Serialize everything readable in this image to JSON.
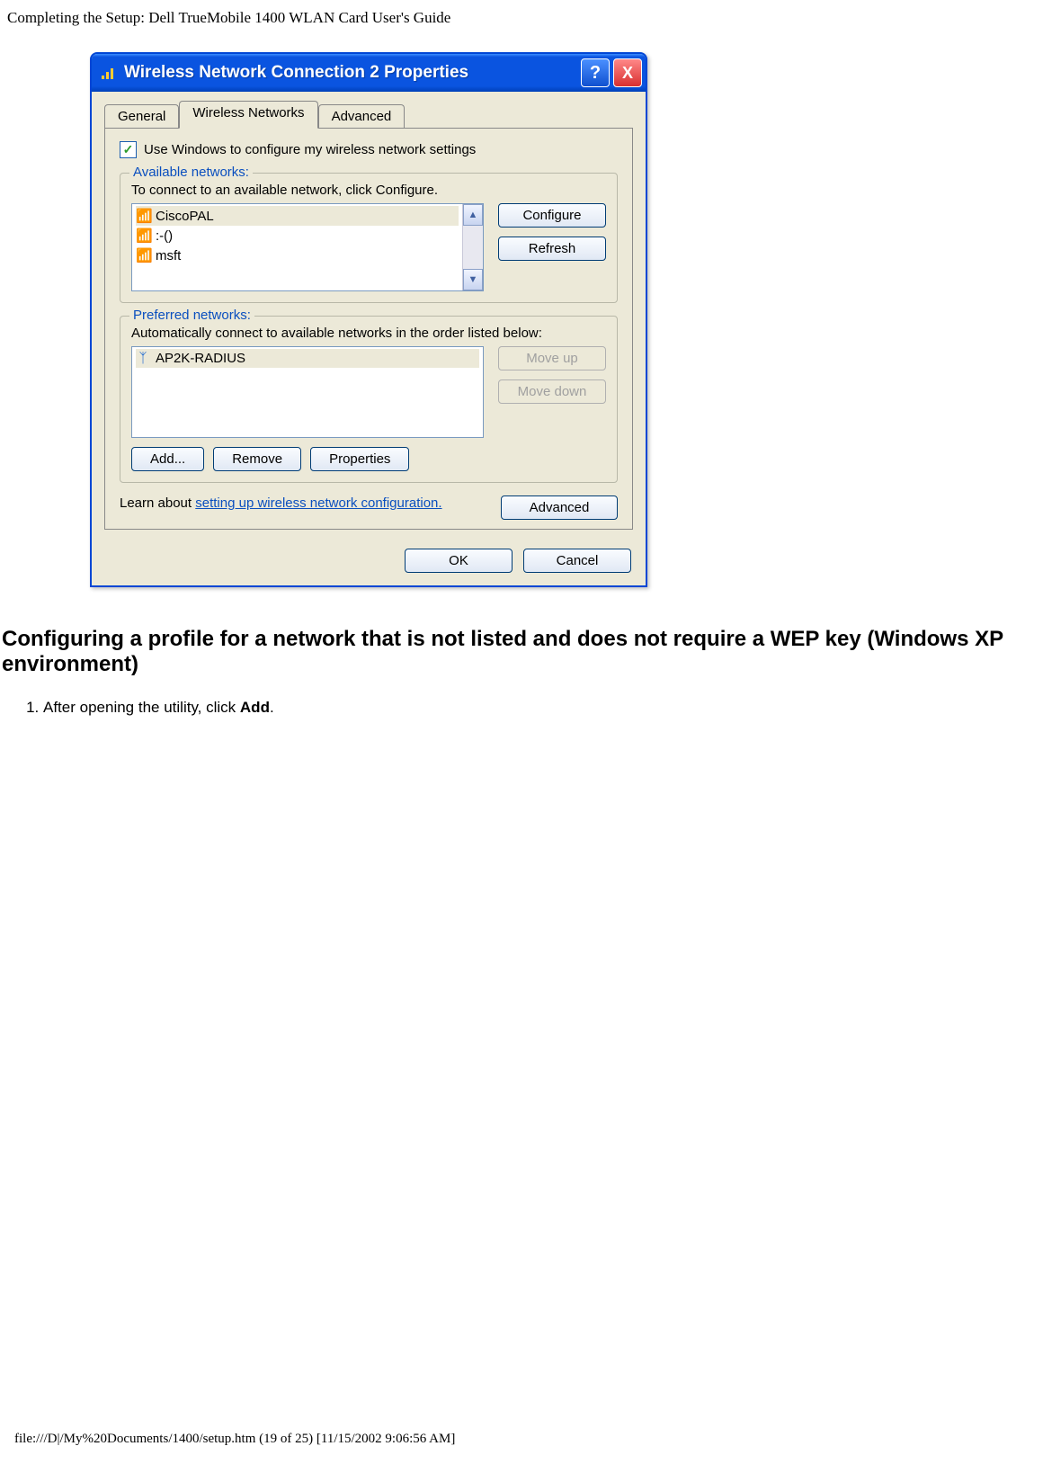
{
  "doc_header": "Completing the Setup: Dell TrueMobile 1400 WLAN Card User's Guide",
  "dialog": {
    "title": "Wireless Network Connection 2 Properties",
    "help_glyph": "?",
    "close_glyph": "X",
    "tabs": {
      "general": "General",
      "wireless": "Wireless Networks",
      "advanced": "Advanced"
    },
    "use_windows_label": "Use Windows to configure my wireless network settings",
    "available": {
      "legend": "Available networks:",
      "hint": "To connect to an available network, click Configure.",
      "items": [
        "CiscoPAL",
        ":-()",
        "msft"
      ],
      "configure": "Configure",
      "refresh": "Refresh"
    },
    "preferred": {
      "legend": "Preferred networks:",
      "hint": "Automatically connect to available networks in the order listed below:",
      "items": [
        "AP2K-RADIUS"
      ],
      "move_up": "Move up",
      "move_down": "Move down",
      "add": "Add...",
      "remove": "Remove",
      "properties": "Properties"
    },
    "learn_prefix": "Learn about ",
    "learn_link": "setting up wireless network configuration.",
    "advanced_btn": "Advanced",
    "ok": "OK",
    "cancel": "Cancel"
  },
  "section_heading": "Configuring a profile for a network that is not listed and does not require a WEP key (Windows XP environment)",
  "step1_prefix": "After opening the utility, click ",
  "step1_bold": "Add",
  "step1_suffix": ".",
  "footer_path": "file:///D|/My%20Documents/1400/setup.htm (19 of 25) [11/15/2002 9:06:56 AM]"
}
